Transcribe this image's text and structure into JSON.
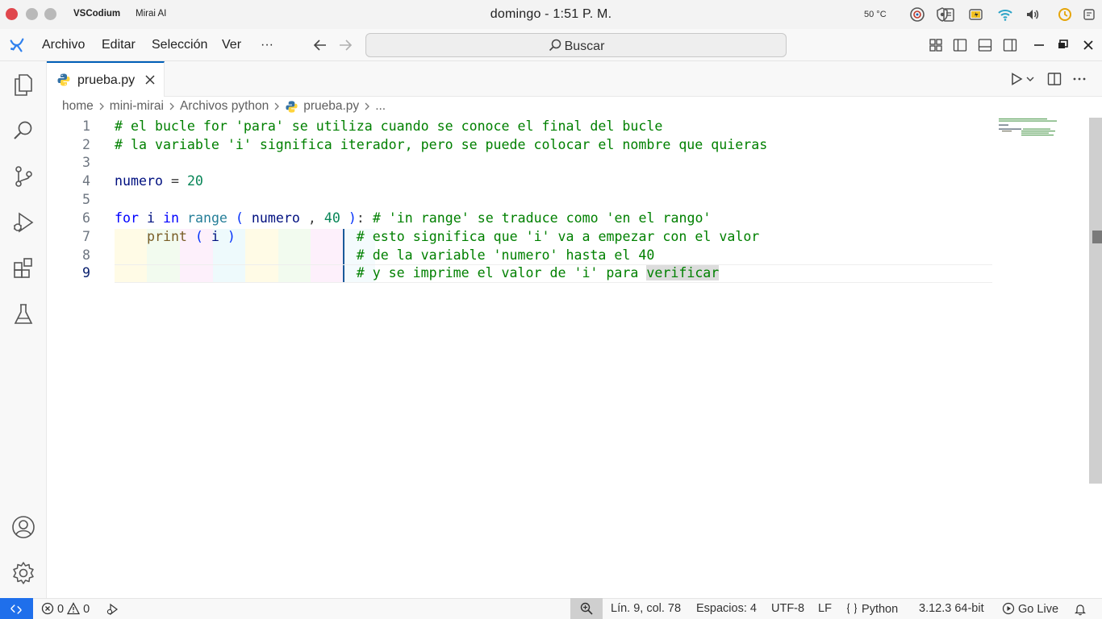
{
  "system_bar": {
    "app_name": "VSCodium",
    "window_title": "Mirai AI",
    "clock": "domingo - 1:51 P. M.",
    "temperature": "50 °C"
  },
  "menu": {
    "items": [
      "Archivo",
      "Editar",
      "Selección",
      "Ver",
      "···"
    ],
    "search_label": "Buscar"
  },
  "tabs": [
    {
      "label": "prueba.py",
      "active": true
    }
  ],
  "breadcrumb": {
    "items": [
      "home",
      "mini-mirai",
      "Archivos python",
      "prueba.py",
      "..."
    ]
  },
  "editor": {
    "language": "python",
    "active_line": 9,
    "lines": [
      {
        "number": "1",
        "text": "# el bucle for 'para' se utiliza cuando se conoce el final del bucle"
      },
      {
        "number": "2",
        "text": "# la variable 'i' significa iterador, pero se puede colocar el nombre que quieras"
      },
      {
        "number": "3",
        "text": ""
      },
      {
        "number": "4",
        "text": "numero = 20"
      },
      {
        "number": "5",
        "text": ""
      },
      {
        "number": "6",
        "text": "for i in range ( numero , 40 ): # 'in range' se traduce como 'en el rango'"
      },
      {
        "number": "7",
        "text": "    print ( i )               # esto significa que 'i' va a empezar con el valor"
      },
      {
        "number": "8",
        "text": "                              # de la variable 'numero' hasta el 40"
      },
      {
        "number": "9",
        "text": "                              # y se imprime el valor de 'i' para verificar"
      }
    ],
    "highlighted_word": "verificar"
  },
  "status_bar": {
    "errors": "0",
    "warnings": "0",
    "cursor_position": "Lín. 9, col. 78",
    "indentation": "Espacios: 4",
    "encoding": "UTF-8",
    "line_ending": "LF",
    "language_mode": "Python",
    "interpreter": "3.12.3 64-bit",
    "live_server": "Go Live"
  },
  "colors": {
    "accent": "#005fb8",
    "remote_button": "#1f6feb",
    "comment": "#008000",
    "keyword": "#0000ff"
  }
}
